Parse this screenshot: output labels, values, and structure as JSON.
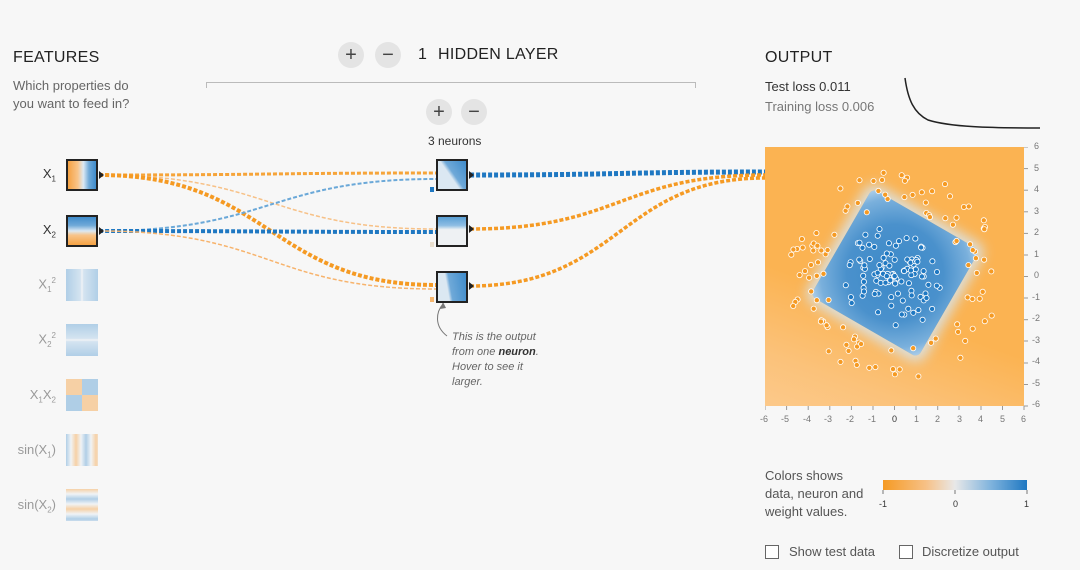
{
  "features": {
    "title": "FEATURES",
    "subtitle_line1": "Which properties do",
    "subtitle_line2": "you want to feed in?",
    "items": [
      {
        "base": "X",
        "sub": "1",
        "sup": "",
        "active": true
      },
      {
        "base": "X",
        "sub": "2",
        "sup": "",
        "active": true
      },
      {
        "base": "X",
        "sub": "1",
        "sup": "2",
        "active": false
      },
      {
        "base": "X",
        "sub": "2",
        "sup": "2",
        "active": false
      },
      {
        "base": "X",
        "sub": "1",
        "mid": "X",
        "sub2": "2",
        "active": false
      },
      {
        "base": "sin(X",
        "sub": "1",
        "tail": ")",
        "active": false
      },
      {
        "base": "sin(X",
        "sub": "2",
        "tail": ")",
        "active": false
      }
    ]
  },
  "hidden": {
    "plus": "+",
    "minus": "−",
    "layer_count": "1",
    "layer_label": "HIDDEN LAYER",
    "neurons_label": "3 neurons",
    "note_pre": "This is the output from one ",
    "note_bold": "neuron",
    "note_post": ". Hover to see it larger."
  },
  "output": {
    "title": "OUTPUT",
    "test_loss": "Test loss 0.011",
    "training_loss": "Training loss 0.006",
    "y_ticks": [
      "6",
      "5",
      "4",
      "3",
      "2",
      "1",
      "0",
      "-1",
      "-2",
      "-3",
      "-4",
      "-5",
      "-6"
    ],
    "x_ticks": [
      "-6",
      "-5",
      "-4",
      "-3",
      "-2",
      "-1",
      "0",
      "1",
      "2",
      "3",
      "4",
      "5",
      "6"
    ],
    "legend_line1": "Colors shows",
    "legend_line2": "data, neuron and",
    "legend_line3": "weight values.",
    "scale_min": "-1",
    "scale_mid": "0",
    "scale_max": "1",
    "show_test_label": "Show test data",
    "discretize_label": "Discretize output"
  },
  "colors": {
    "orange": "#f59a23",
    "blue": "#1f78c2",
    "bg": "#f7f7f7"
  }
}
